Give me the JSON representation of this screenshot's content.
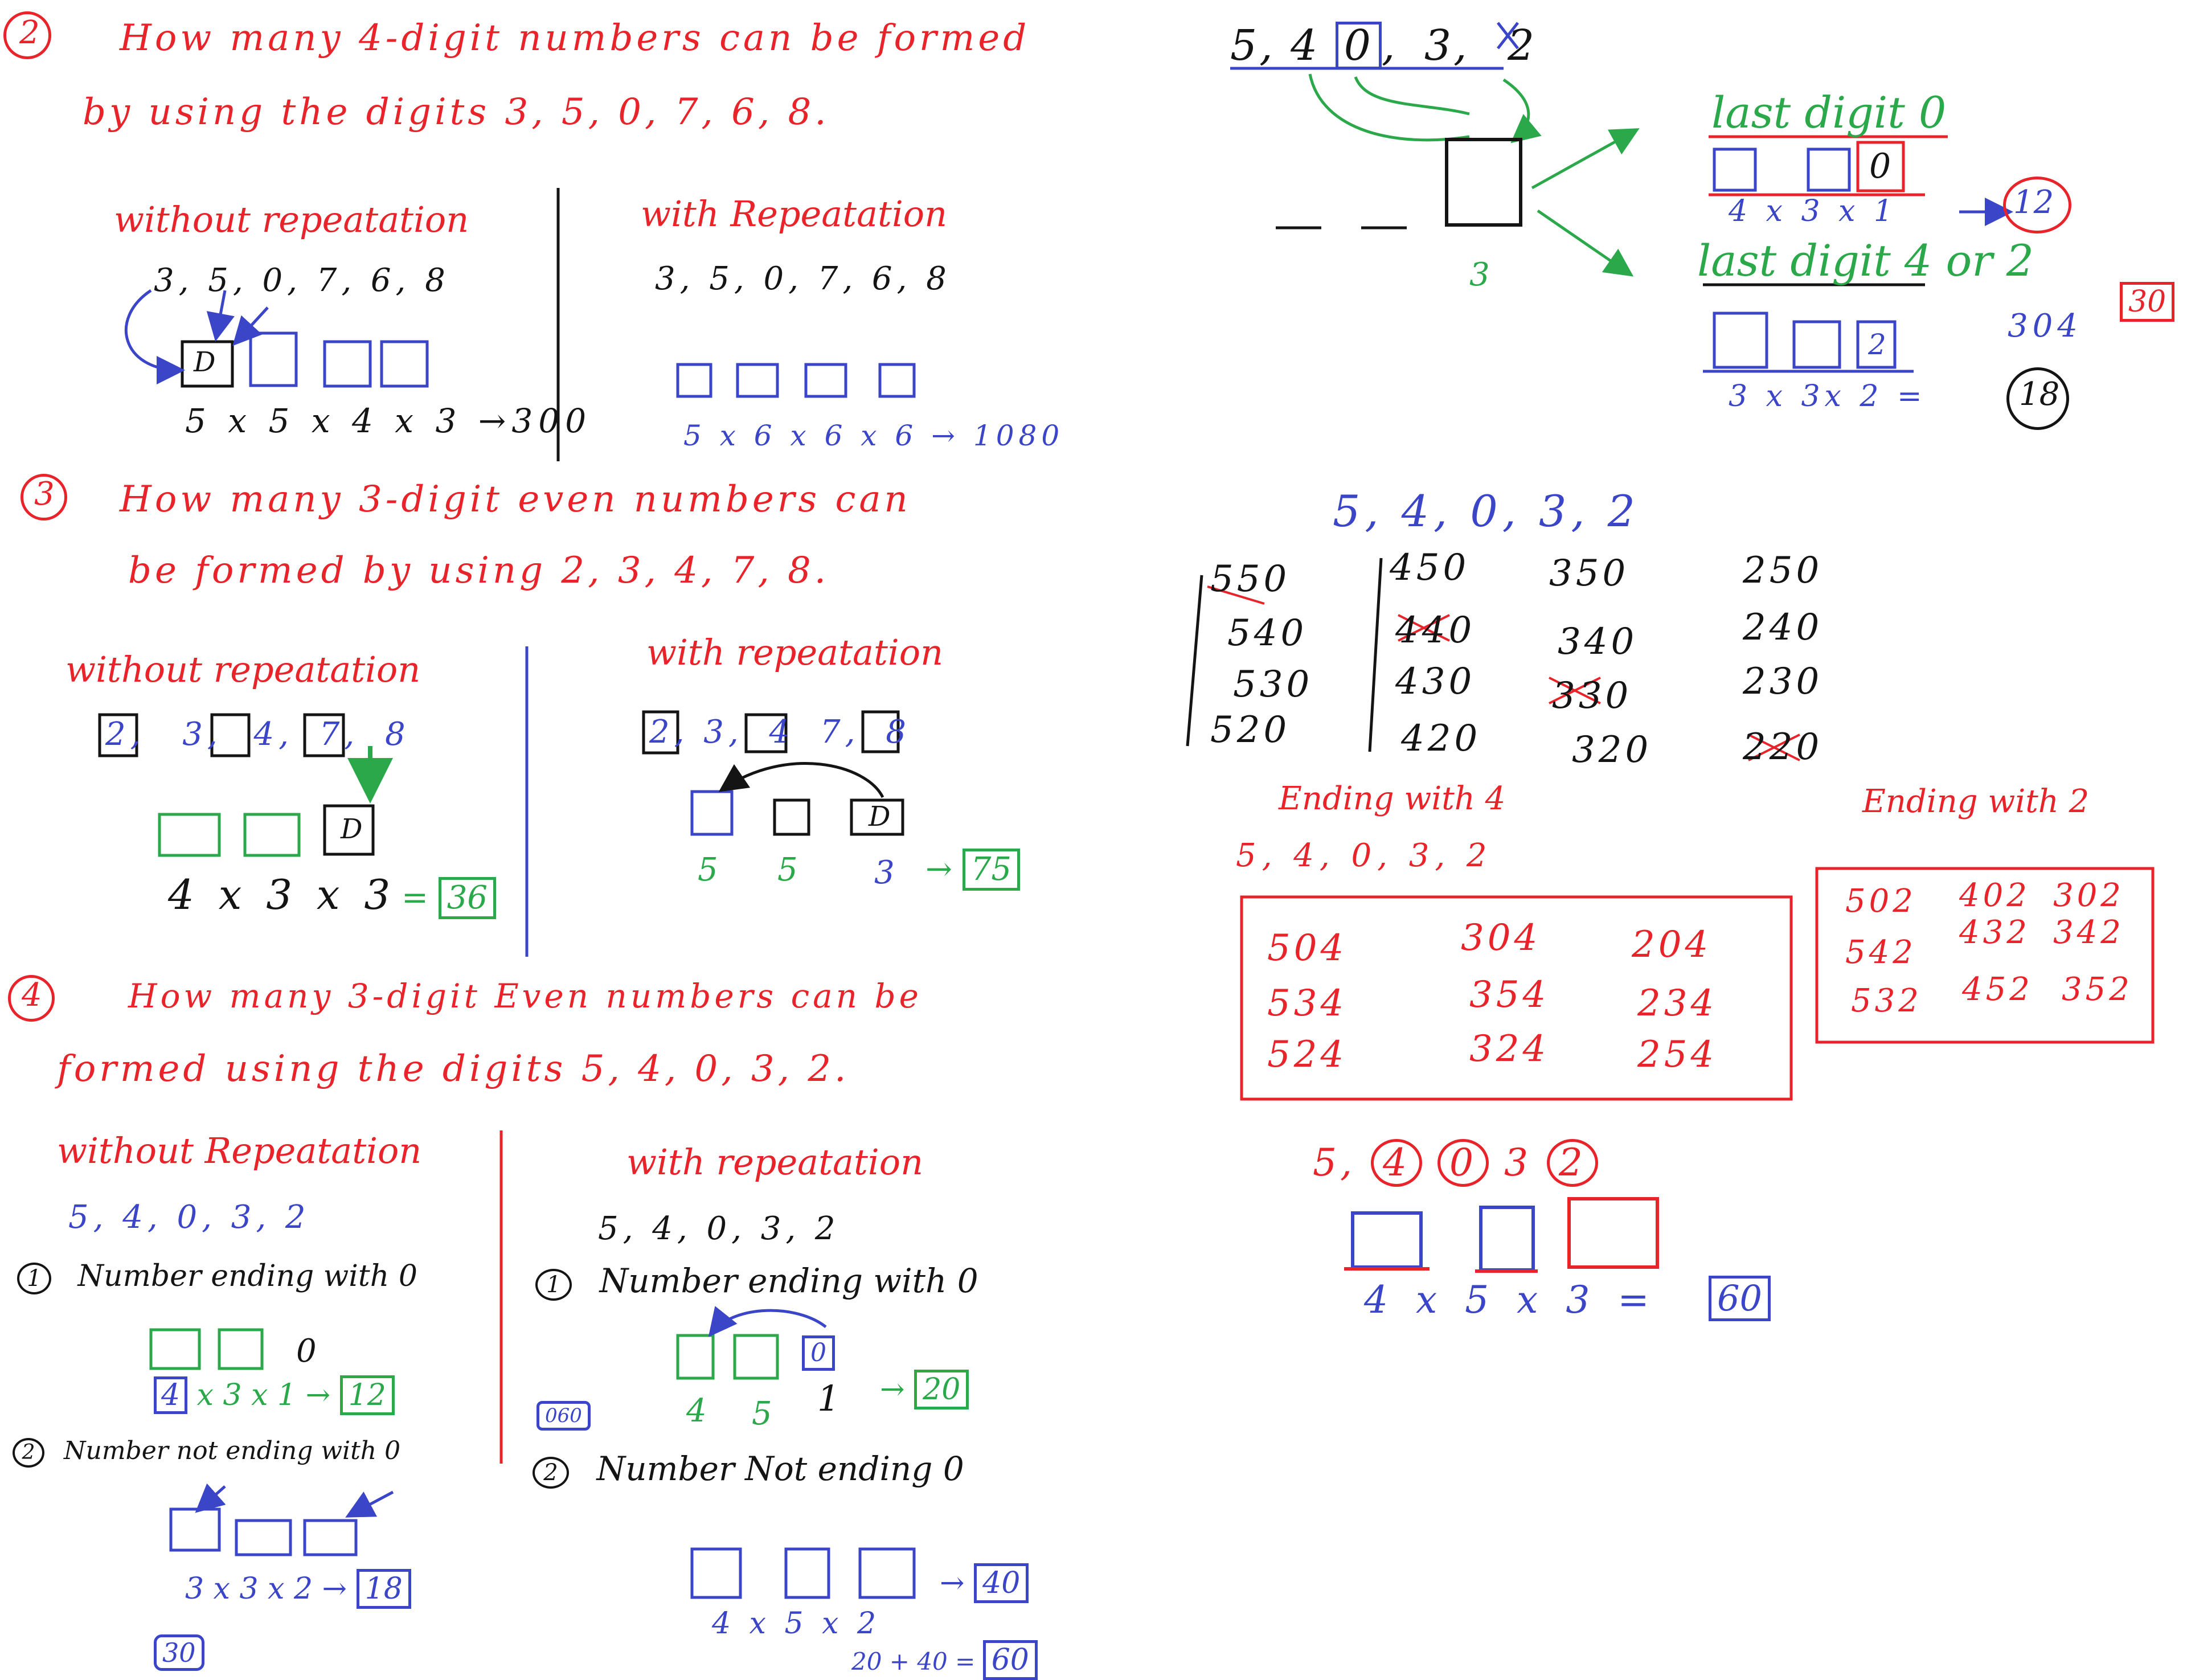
{
  "q2": {
    "number": "2",
    "line1": "How many 4-digit numbers can be formed",
    "line2": "by using the digits 3, 5, 0, 7, 6, 8.",
    "without": {
      "heading": "without repeatation",
      "digits": "3, 5, 0, 7, 6, 8",
      "box_label": "D",
      "calc": "5 x 5 x 4 x 3 →300"
    },
    "with": {
      "heading": "with Repeatation",
      "digits": "3, 5, 0, 7, 6, 8",
      "calc": "5 x 6 x 6 x 6 → 1080"
    }
  },
  "q3": {
    "number": "3",
    "line1": "How many 3-digit even numbers can",
    "line2": "be formed by using 2, 3, 4, 7, 8.",
    "without": {
      "heading": "without repeatation",
      "digits": [
        "2",
        "3",
        "4",
        "7",
        "8"
      ],
      "box_label": "D",
      "calc": "4 x 3 x 3",
      "result": "36"
    },
    "with": {
      "heading": "with repeatation",
      "digits": [
        "2",
        "3",
        "4",
        "7",
        "8"
      ],
      "box_label": "D",
      "counts": [
        "5",
        "5",
        "3"
      ],
      "result": "75"
    }
  },
  "q4": {
    "number": "4",
    "line1": "How many 3-digit Even numbers can be",
    "line2": "formed using the digits 5, 4, 0, 3, 2.",
    "without": {
      "heading": "without Repeatation",
      "digits": "5, 4, 0, 3, 2",
      "case1_num": "1",
      "case1": "Number ending with 0",
      "case1_last": "0",
      "case1_calc_first": "4",
      "case1_calc": "x 3 x 1 →",
      "case1_result": "12",
      "case2_num": "2",
      "case2": "Number not ending with 0",
      "case2_calc": "3 x 3 x 2 →",
      "case2_result": "18",
      "total": "30"
    },
    "with": {
      "heading": "with repeatation",
      "digits": "5, 4, 0, 3, 2",
      "case1_num": "1",
      "case1": "Number ending with 0",
      "case1_last": "0",
      "case1_counts": [
        "4",
        "5",
        "1"
      ],
      "case1_result": "20",
      "side_box": "060",
      "case2_num": "2",
      "case2": "Number Not ending 0",
      "case2_calc": "4 x 5 x 2",
      "case2_result": "40",
      "sum": "20 + 40 =",
      "total": "60"
    }
  },
  "right": {
    "top_digits": [
      "5",
      "4",
      "0",
      "3",
      "2"
    ],
    "pos_count": "3",
    "last0": {
      "heading": "last digit 0",
      "box_label": "0",
      "calc": "4 x 3 x 1",
      "result": "12"
    },
    "last42": {
      "heading": "last digit 4 or 2",
      "box_label": "2",
      "calc": "3 x 3x 2 =",
      "result": "18",
      "side_note": "304",
      "total": "30"
    },
    "list_digits": "5, 4, 0, 3, 2",
    "columns": [
      [
        "550",
        "540",
        "530",
        "520"
      ],
      [
        "450",
        "440",
        "430",
        "420"
      ],
      [
        "350",
        "340",
        "330",
        "320"
      ],
      [
        "250",
        "240",
        "230",
        "220"
      ]
    ],
    "ending4": {
      "heading": "Ending with 4",
      "digits": "5, 4, 0, 3, 2",
      "rows": [
        [
          "504",
          "304",
          "204"
        ],
        [
          "534",
          "354",
          "234"
        ],
        [
          "524",
          "324",
          "254"
        ]
      ]
    },
    "ending2": {
      "heading": "Ending with 2",
      "rows": [
        [
          "502",
          "402",
          "302"
        ],
        [
          "542",
          "432",
          "342"
        ],
        [
          "532",
          "452",
          "352"
        ]
      ]
    },
    "bottom": {
      "digits": [
        "5",
        "4",
        "0",
        "3",
        "2"
      ],
      "calc": "4 x 5 x 3 =",
      "result": "60"
    }
  }
}
